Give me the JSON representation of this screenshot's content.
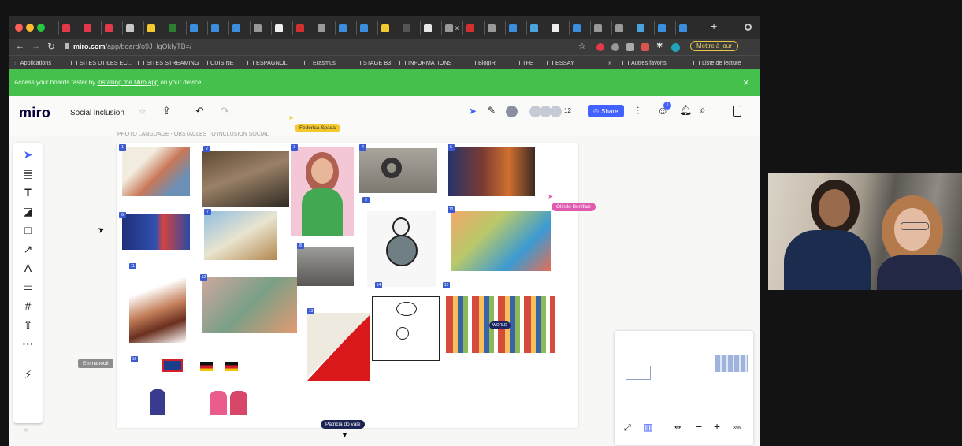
{
  "browser": {
    "new_tab_symbol": "+",
    "tab_close": "x",
    "address": {
      "domain": "miro.com",
      "path": "/app/board/o9J_lqOkIyTB=/",
      "lock_icon": "lock-icon"
    },
    "update_button": "Mettre à jour",
    "bookmarks": [
      "Applications",
      "SITES UTILES EC...",
      "SITES STREAMING",
      "CUISINE",
      "ESPAGNOL",
      "Erasmus",
      "STAGE B3",
      "INFORMATIONS",
      "BlogIR",
      "TFE",
      "ESSAY"
    ],
    "bookmarks_overflow": "»",
    "other_bookmarks": "Autres favoris",
    "reading_list": "Liste de lecture"
  },
  "banner": {
    "prefix": "Access your boards faster by ",
    "link": "installing the Miro app",
    "suffix": " on your device",
    "close": "×"
  },
  "miro": {
    "logo": "miro",
    "board_name": "Social inclusion",
    "collaborator_count": "12",
    "notification_count": "1",
    "share_label": "Share",
    "accent": "#4262ff",
    "frame_title": "PHOTO LANGUAGE - OBSTACLES TO INCLUSION SOCIAL",
    "image_numbers": [
      "1",
      "2",
      "3",
      "4",
      "5",
      "6",
      "7",
      "8",
      "9",
      "10",
      "11",
      "12",
      "13",
      "14",
      "15",
      "16"
    ],
    "sticker_text": "WORLD",
    "zoom": "3%",
    "collapse": "«"
  },
  "cursors": [
    {
      "name": "Federica Spada",
      "color": "#f4c82f"
    },
    {
      "name": "Olindo Bonifazi",
      "color": "#e05bb0"
    },
    {
      "name": "Emmanouil",
      "color": "#8c8c8c"
    },
    {
      "name": "Patricia do vale",
      "color": "#1c2455"
    }
  ]
}
